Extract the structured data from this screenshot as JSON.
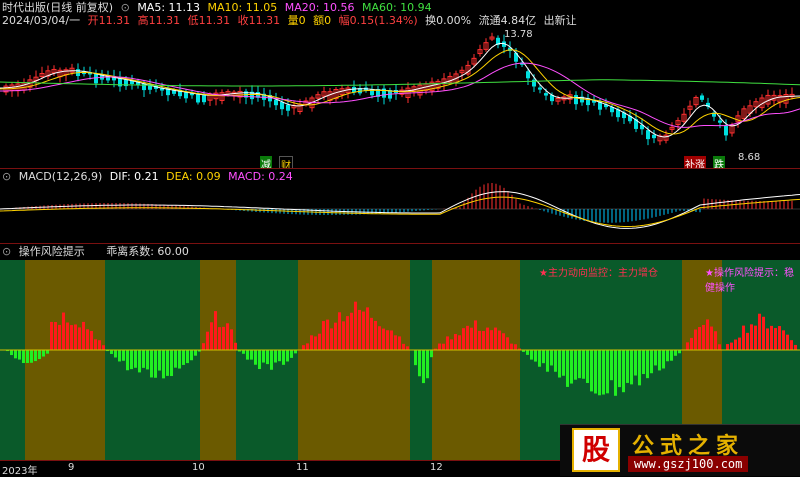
{
  "header": {
    "title": "时代出版(日线 前复权)",
    "ma": [
      {
        "label": "MA5: 11.13",
        "color": "#ffffff"
      },
      {
        "label": "MA10: 11.05",
        "color": "#ffd200"
      },
      {
        "label": "MA20: 10.56",
        "color": "#ff50ff"
      },
      {
        "label": "MA60: 10.94",
        "color": "#40e040"
      }
    ],
    "info_date": "2024/03/04/一",
    "info": [
      {
        "label": "开11.31",
        "color": "#ff4040"
      },
      {
        "label": "高11.31",
        "color": "#ff4040"
      },
      {
        "label": "低11.31",
        "color": "#ff4040"
      },
      {
        "label": "收11.31",
        "color": "#ff4040"
      },
      {
        "label": "量0",
        "color": "#ffd200"
      },
      {
        "label": "额0",
        "color": "#ffd200"
      },
      {
        "label": "幅0.15(1.34%)",
        "color": "#ff4040"
      },
      {
        "label": "换0.00%",
        "color": "#dddddd"
      },
      {
        "label": "流通4.84亿",
        "color": "#dddddd"
      },
      {
        "label": "出新让",
        "color": "#dddddd"
      }
    ],
    "high_label": "13.78",
    "low_label": "8.68",
    "marks": {
      "jian": "减",
      "cai": "财",
      "xiu": "补涨",
      "die": "跌"
    }
  },
  "macd": {
    "title": "MACD(12,26,9)",
    "dif": "DIF: 0.21",
    "dea": "DEA: 0.09",
    "macd": "MACD: 0.24"
  },
  "risk": {
    "title": "操作风险提示",
    "coef": "乖离系数: 60.00",
    "note1": "★主力动向监控：主力增仓",
    "note2": "★操作风险提示：稳健操作"
  },
  "axis": {
    "labels": [
      "2023年",
      "9",
      "10",
      "11",
      "12"
    ]
  },
  "logo": {
    "big": "股",
    "name": "公式之家",
    "url": "www.gszj100.com"
  },
  "colors": {
    "up": "#ff3030",
    "down": "#00e0e0",
    "green_zone": "#0a5a2a",
    "olive_zone": "#6b5a00",
    "bar_up": "#ff1a1a",
    "bar_down": "#22ee22"
  }
}
